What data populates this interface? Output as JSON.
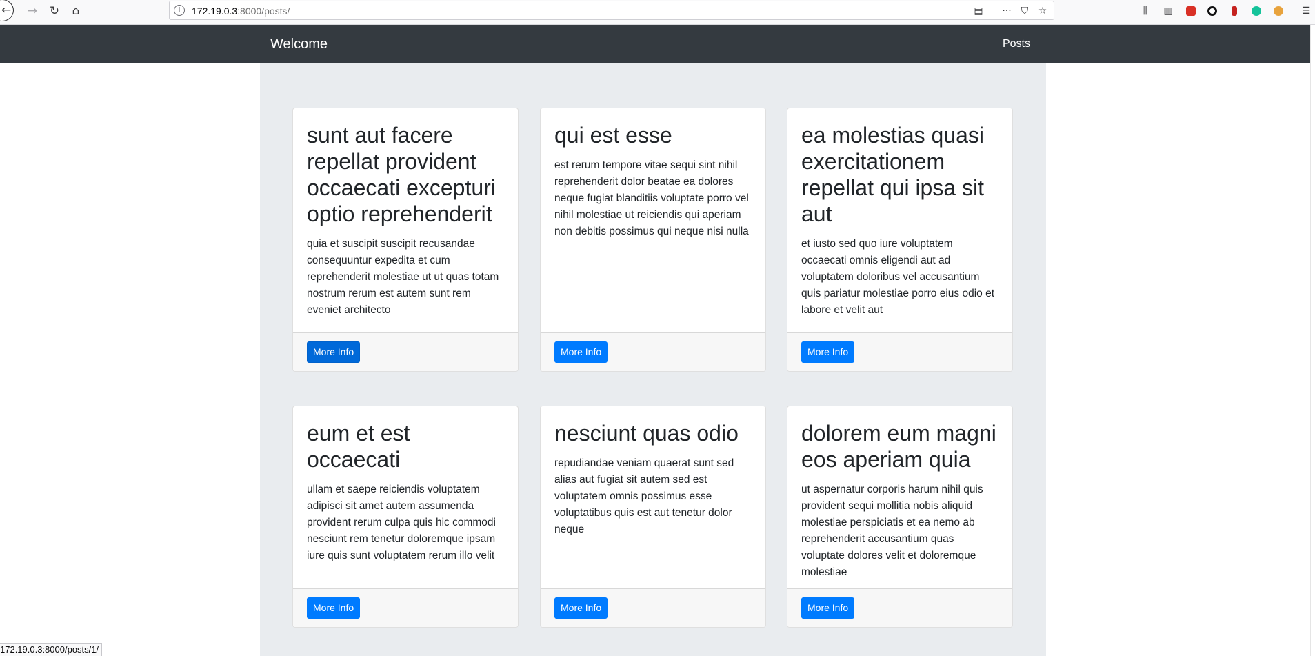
{
  "browser": {
    "url_host": "172.19.0.3",
    "url_path": ":8000/posts/",
    "status_url": "172.19.0.3:8000/posts/1/"
  },
  "navbar": {
    "brand": "Welcome",
    "links": [
      "Posts"
    ]
  },
  "posts": [
    {
      "title": "sunt aut facere repellat provident occaecati excepturi optio reprehenderit",
      "body": "quia et suscipit suscipit recusandae consequuntur expedita et cum reprehenderit molestiae ut ut quas totam nostrum rerum est autem sunt rem eveniet architecto",
      "button": "More Info"
    },
    {
      "title": "qui est esse",
      "body": "est rerum tempore vitae sequi sint nihil reprehenderit dolor beatae ea dolores neque fugiat blanditiis voluptate porro vel nihil molestiae ut reiciendis qui aperiam non debitis possimus qui neque nisi nulla",
      "button": "More Info"
    },
    {
      "title": "ea molestias quasi exercitationem repellat qui ipsa sit aut",
      "body": "et iusto sed quo iure voluptatem occaecati omnis eligendi aut ad voluptatem doloribus vel accusantium quis pariatur molestiae porro eius odio et labore et velit aut",
      "button": "More Info"
    },
    {
      "title": "eum et est occaecati",
      "body": "ullam et saepe reiciendis voluptatem adipisci sit amet autem assumenda provident rerum culpa quis hic commodi nesciunt rem tenetur doloremque ipsam iure quis sunt voluptatem rerum illo velit",
      "button": "More Info"
    },
    {
      "title": "nesciunt quas odio",
      "body": "repudiandae veniam quaerat sunt sed alias aut fugiat sit autem sed est voluptatem omnis possimus esse voluptatibus quis est aut tenetur dolor neque",
      "button": "More Info"
    },
    {
      "title": "dolorem eum magni eos aperiam quia",
      "body": "ut aspernatur corporis harum nihil quis provident sequi mollitia nobis aliquid molestiae perspiciatis et ea nemo ab reprehenderit accusantium quas voluptate dolores velit et doloremque molestiae",
      "button": "More Info"
    }
  ],
  "colors": {
    "navbar_bg": "#343a40",
    "container_bg": "#e9ecef",
    "button_primary": "#007bff",
    "button_hover": "#0069d9"
  },
  "icons": {
    "back": "back-arrow-icon",
    "forward": "forward-arrow-icon",
    "reload": "reload-icon",
    "home": "home-icon",
    "site_info": "info-icon",
    "reader": "reader-view-icon",
    "page_actions": "more-dots-icon",
    "pocket": "pocket-icon",
    "bookmark": "star-icon",
    "library": "library-icon",
    "sidebar": "sidebar-icon",
    "menu": "hamburger-menu-icon"
  }
}
